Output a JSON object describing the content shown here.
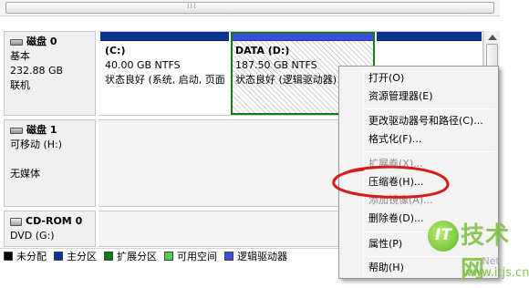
{
  "scrollbar": {
    "grip": "⁞⁞⁞"
  },
  "disks": [
    {
      "title": "磁盘 0",
      "type": "基本",
      "size": "232.88 GB",
      "status": "联机",
      "partitions": [
        {
          "name": "(C:)",
          "info": "40.00 GB NTFS",
          "status": "状态良好 (系统, 启动, 页面"
        },
        {
          "name": "DATA  (D:)",
          "info": "187.50 GB NTFS",
          "status": "状态良好 (逻辑驱动器)"
        }
      ]
    },
    {
      "title": "磁盘 1",
      "type": "可移动 (H:)",
      "media": "无媒体"
    },
    {
      "title": "CD-ROM 0",
      "type": "DVD (G:)"
    }
  ],
  "legend": [
    {
      "label": "未分配",
      "color": "#000000"
    },
    {
      "label": "主分区",
      "color": "#0b3391"
    },
    {
      "label": "扩展分区",
      "color": "#147c14"
    },
    {
      "label": "可用空间",
      "color": "#4bd24b"
    },
    {
      "label": "逻辑驱动器",
      "color": "#3c4fe0"
    }
  ],
  "context_menu": {
    "items": [
      {
        "label": "打开(O)",
        "enabled": true
      },
      {
        "label": "资源管理器(E)",
        "enabled": true
      },
      {
        "label": "更改驱动器号和路径(C)...",
        "enabled": true
      },
      {
        "label": "格式化(F)...",
        "enabled": true
      },
      {
        "label": "扩展卷(X)...",
        "enabled": false
      },
      {
        "label": "压缩卷(H)...",
        "enabled": true
      },
      {
        "label": "添加镜像(A)...",
        "enabled": false
      },
      {
        "label": "删除卷(D)...",
        "enabled": true
      },
      {
        "label": "属性(P)",
        "enabled": true
      },
      {
        "label": "帮助(H)",
        "enabled": true
      }
    ]
  },
  "annotation_color": "#d81b1b",
  "watermark": {
    "logo": "IT",
    "brand": "技术网",
    "site": "www.itjs.cn",
    "suffix": ".Net"
  }
}
